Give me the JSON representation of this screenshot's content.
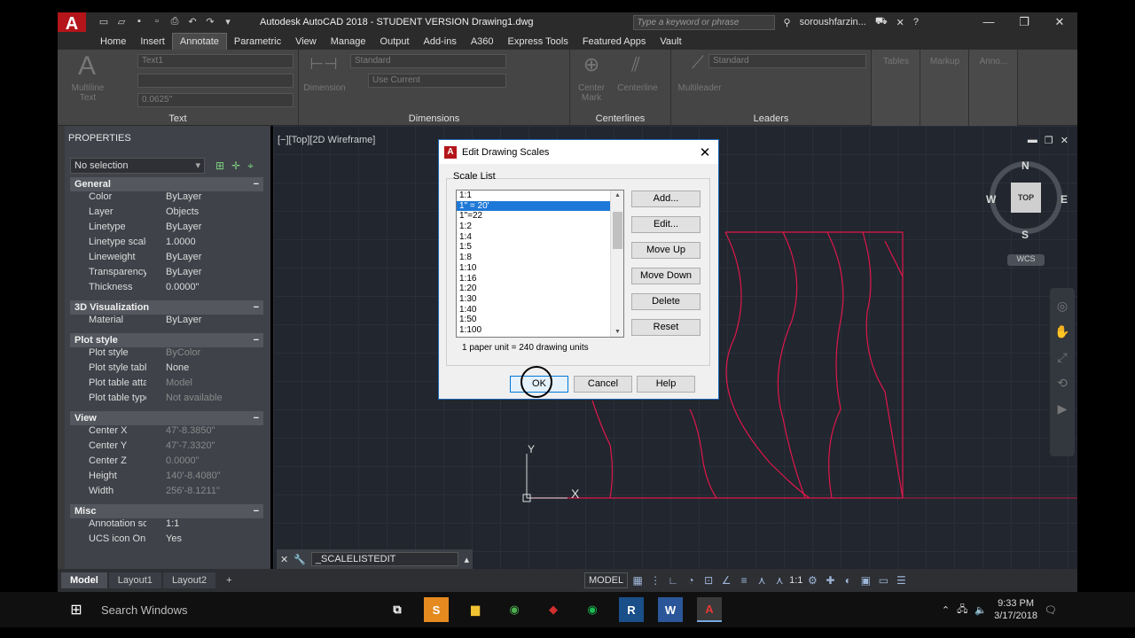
{
  "titlebar": {
    "app_logo": "A",
    "title": "Autodesk AutoCAD 2018 - STUDENT VERSION    Drawing1.dwg",
    "search_placeholder": "Type a keyword or phrase",
    "user": "soroushfarzin..."
  },
  "ribbon_tabs": [
    "Home",
    "Insert",
    "Annotate",
    "Parametric",
    "View",
    "Manage",
    "Output",
    "Add-ins",
    "A360",
    "Express Tools",
    "Featured Apps",
    "Vault"
  ],
  "ribbon_active_tab": "Annotate",
  "ribbon": {
    "text_panel": {
      "label": "Text",
      "big_button": "Multiline\nText",
      "style_value": "Text1",
      "height_value": "0.0625\""
    },
    "dimensions_panel": {
      "label": "Dimensions",
      "big_button": "Dimension",
      "style_value": "Standard",
      "layer_value": "Use Current"
    },
    "centerlines_panel": {
      "label": "Centerlines",
      "btn1": "Center\nMark",
      "btn2": "Centerline"
    },
    "leaders_panel": {
      "label": "Leaders",
      "big_button": "Multileader",
      "style_value": "Standard"
    },
    "extra_panels": [
      "Tables",
      "Markup",
      "Anno..."
    ]
  },
  "properties": {
    "title": "PROPERTIES",
    "selection": "No selection",
    "sections": [
      {
        "name": "General",
        "rows": [
          {
            "k": "Color",
            "v": "ByLayer"
          },
          {
            "k": "Layer",
            "v": "Objects"
          },
          {
            "k": "Linetype",
            "v": "ByLayer"
          },
          {
            "k": "Linetype scale",
            "v": "1.0000"
          },
          {
            "k": "Lineweight",
            "v": "ByLayer"
          },
          {
            "k": "Transparency",
            "v": "ByLayer"
          },
          {
            "k": "Thickness",
            "v": "0.0000\""
          }
        ]
      },
      {
        "name": "3D Visualization",
        "rows": [
          {
            "k": "Material",
            "v": "ByLayer"
          }
        ]
      },
      {
        "name": "Plot style",
        "rows": [
          {
            "k": "Plot style",
            "v": "ByColor",
            "dim": true
          },
          {
            "k": "Plot style table",
            "v": "None"
          },
          {
            "k": "Plot table attac...",
            "v": "Model",
            "dim": true
          },
          {
            "k": "Plot table type",
            "v": "Not available",
            "dim": true
          }
        ]
      },
      {
        "name": "View",
        "rows": [
          {
            "k": "Center X",
            "v": "47'-8.3850\"",
            "dim": true
          },
          {
            "k": "Center Y",
            "v": "47'-7.3320\"",
            "dim": true
          },
          {
            "k": "Center Z",
            "v": "0.0000\"",
            "dim": true
          },
          {
            "k": "Height",
            "v": "140'-8.4080\"",
            "dim": true
          },
          {
            "k": "Width",
            "v": "256'-8.1211\"",
            "dim": true
          }
        ]
      },
      {
        "name": "Misc",
        "rows": [
          {
            "k": "Annotation sca...",
            "v": "1:1"
          },
          {
            "k": "UCS icon On",
            "v": "Yes"
          }
        ]
      }
    ]
  },
  "viewport": {
    "label": "[−][Top][2D Wireframe]",
    "compass": {
      "n": "N",
      "s": "S",
      "e": "E",
      "w": "W",
      "top": "TOP"
    },
    "wcs": "WCS",
    "ucs_x": "X",
    "ucs_y": "Y"
  },
  "command_line": {
    "value": "_SCALELISTEDIT"
  },
  "model_tabs": [
    "Model",
    "Layout1",
    "Layout2"
  ],
  "status_bar": {
    "model": "MODEL",
    "scale": "1:1"
  },
  "dialog": {
    "title": "Edit Drawing Scales",
    "group_label": "Scale List",
    "scales": [
      "1:1",
      "1\" = 20'",
      "1\"=22",
      "1:2",
      "1:4",
      "1:5",
      "1:8",
      "1:10",
      "1:16",
      "1:20",
      "1:30",
      "1:40",
      "1:50",
      "1:100"
    ],
    "selected_index": 1,
    "side_buttons": [
      "Add...",
      "Edit...",
      "Move Up",
      "Move Down",
      "Delete",
      "Reset"
    ],
    "unit_text": "1 paper unit = 240 drawing units",
    "ok": "OK",
    "cancel": "Cancel",
    "help": "Help"
  },
  "taskbar": {
    "search": "Search Windows",
    "time": "9:33 PM",
    "date": "3/17/2018"
  },
  "colors": {
    "drawing_lines": "#e0174a",
    "viewport_bg": "#21262f",
    "selection": "#1e78d7",
    "autocad_red": "#b3151a"
  }
}
